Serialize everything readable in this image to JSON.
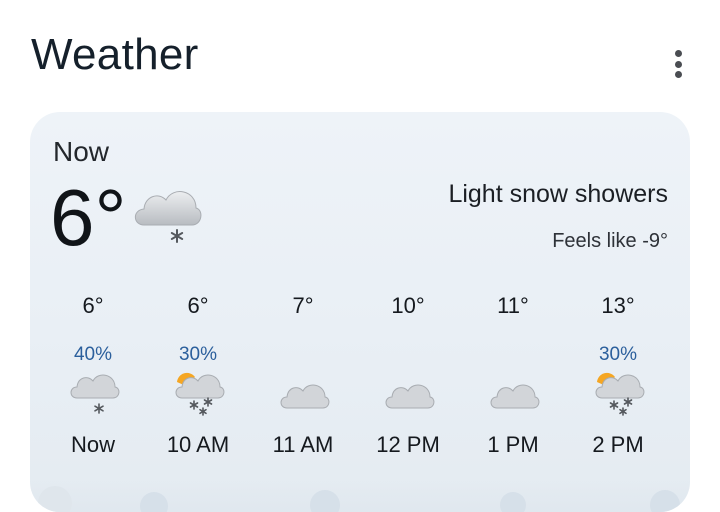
{
  "header": {
    "title": "Weather"
  },
  "current": {
    "label": "Now",
    "temperature": "6°",
    "condition": "Light snow showers",
    "feels_like": "Feels like -9°",
    "icon": "cloud-snow-icon"
  },
  "hourly": [
    {
      "temp": "6°",
      "precip": "40%",
      "label": "Now",
      "icon": "cloud-snow-icon"
    },
    {
      "temp": "6°",
      "precip": "30%",
      "label": "10 AM",
      "icon": "partly-sunny-snow-icon"
    },
    {
      "temp": "7°",
      "precip": "",
      "label": "11 AM",
      "icon": "cloud-icon"
    },
    {
      "temp": "10°",
      "precip": "",
      "label": "12 PM",
      "icon": "cloud-icon"
    },
    {
      "temp": "11°",
      "precip": "",
      "label": "1 PM",
      "icon": "cloud-icon"
    },
    {
      "temp": "13°",
      "precip": "30%",
      "label": "2 PM",
      "icon": "partly-sunny-snow-icon"
    }
  ],
  "colors": {
    "precip": "#2b5f9c",
    "card_bg": "#eef3f8",
    "sun": "#f5a623",
    "cloud": "#c9cdd2"
  }
}
